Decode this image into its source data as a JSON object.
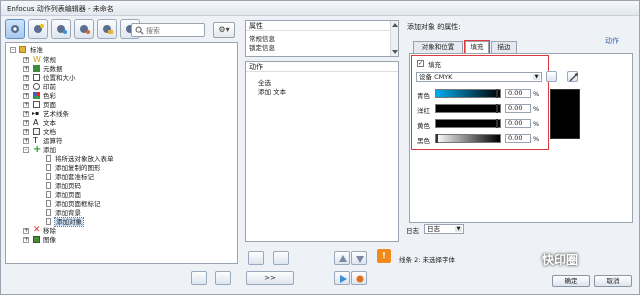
{
  "window": {
    "title": "Enfocus 动作列表编辑器 - 未命名"
  },
  "search": {
    "placeholder": "搜索"
  },
  "tree": {
    "root": "标准",
    "items": [
      {
        "label": "常规"
      },
      {
        "label": "元数据"
      },
      {
        "label": "位置和大小"
      },
      {
        "label": "印前"
      },
      {
        "label": "色彩"
      },
      {
        "label": "页面"
      },
      {
        "label": "艺术线条"
      },
      {
        "label": "文本"
      },
      {
        "label": "文档"
      },
      {
        "label": "运算符"
      },
      {
        "label": "添加"
      },
      {
        "label": "将所选对象放入表单"
      },
      {
        "label": "添加复制的图形"
      },
      {
        "label": "添加套准标记"
      },
      {
        "label": "添加页码"
      },
      {
        "label": "添加页面"
      },
      {
        "label": "添加页面框标记"
      },
      {
        "label": "添加背景"
      },
      {
        "label": "添加对象"
      },
      {
        "label": "移除"
      },
      {
        "label": "图像"
      }
    ]
  },
  "properties": {
    "header": "属性",
    "items": [
      "常规信息",
      "锁定信息"
    ]
  },
  "actions": {
    "header": "动作",
    "items": [
      "全选",
      "添加 文本"
    ]
  },
  "right": {
    "title": "添加对象 的属性:",
    "link": "动作",
    "tabs": [
      "对象和位置",
      "填充",
      "描边"
    ],
    "fill_checkbox": "✓",
    "fill_label": "填充",
    "device": "设备 CMYK",
    "channels": [
      {
        "label": "青色",
        "value": "0.00",
        "unit": "%",
        "color": "#00aeef"
      },
      {
        "label": "洋红",
        "value": "0.00",
        "unit": "%",
        "color": "#ec008c"
      },
      {
        "label": "黄色",
        "value": "0.00",
        "unit": "%",
        "color": "#fff200"
      },
      {
        "label": "黑色",
        "value": "0.00",
        "unit": "%",
        "color": "#000000"
      }
    ],
    "log_label": "日志",
    "log_value": "日志",
    "status": "线条 2: 未选择字体"
  },
  "buttons": {
    "forward": ">>",
    "ok": "确定",
    "cancel": "取消"
  },
  "watermark": "快印圈",
  "colors": {
    "highlight_red": "#e0393e",
    "accent_blue": "#3366aa",
    "warning_orange": "#f08a1c"
  }
}
